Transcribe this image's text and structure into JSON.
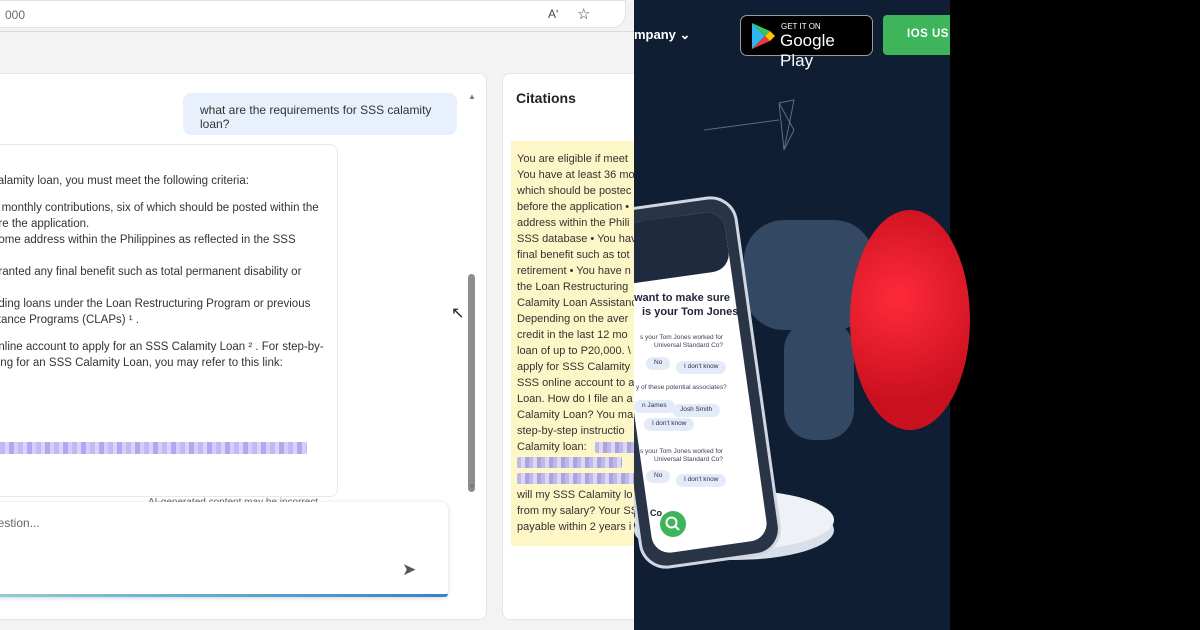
{
  "browser": {
    "address_fragment": "000",
    "read_aloud_glyph": "Aʹ",
    "favorite_glyph": "☆"
  },
  "chat": {
    "user_message": "what are the requirements for SSS calamity loan?",
    "answer_lines": [
      "calamity loan, you must meet the following criteria:",
      "6 monthly contributions, six of which should be posted within the",
      "ore the application.",
      "home address within the Philippines as reflected in the SSS",
      "granted any final benefit such as total permanent disability or",
      "nding loans under the Loan Restructuring Program or previous",
      "stance Programs (CLAPs) ¹ .",
      "online account to apply for an SSS Calamity Loan ² . For step-by-",
      "ving for an SSS Calamity Loan, you may refer to this link:"
    ],
    "ai_note": "AI-generated content may be incorrect",
    "input_placeholder": "uestion...",
    "send_glyph": "➤"
  },
  "citations": {
    "title": "Citations",
    "lines": [
      "You are eligible if meet",
      "You have at least 36 mo",
      "which should be postec",
      "before the application •",
      "address within the Phili",
      "SSS database • You hav",
      "final benefit such as tot",
      "retirement • You have n",
      "the Loan Restructuring",
      "Calamity Loan Assistanc",
      "Depending on the aver",
      "credit in the last 12 mo",
      "loan of up to P20,000. \\",
      "apply for SSS Calamity",
      "SSS online account to a",
      "Loan. How do I file an a",
      "Calamity Loan? You ma",
      "step-by-step instructio",
      "Calamity loan:"
    ],
    "lines_after": [
      "will my SSS Calamity lo",
      "from my salary? Your SS",
      "payable within 2 years i"
    ]
  },
  "promo": {
    "company_label": "mpany",
    "gplay_small": "GET IT ON",
    "gplay_big": "Google Play",
    "ios_button": "IOS US",
    "phone": {
      "heading_line1": "want to make sure",
      "heading_line2": "is your Tom Jones",
      "q1_line1": "s your Tom Jones worked for",
      "q1_line2": "Universal Standard Co?",
      "q1_options": [
        "No",
        "I don't know"
      ],
      "q2": "y of these potential associates?",
      "q2_options": [
        "n James",
        "Josh Smith",
        "I don't know"
      ],
      "q3_line1": "s your Tom Jones worked for",
      "q3_line2": "Universal Standard Co?",
      "q3_options": [
        "No",
        "I don't know"
      ],
      "continue": "Co"
    }
  },
  "colors": {
    "user_bubble": "#e8f0fb",
    "citation_highlight": "#fdf6c7",
    "promo_bg": "#0f1e33",
    "ios_green": "#3fb55b",
    "red_accent": "#c0262d"
  }
}
